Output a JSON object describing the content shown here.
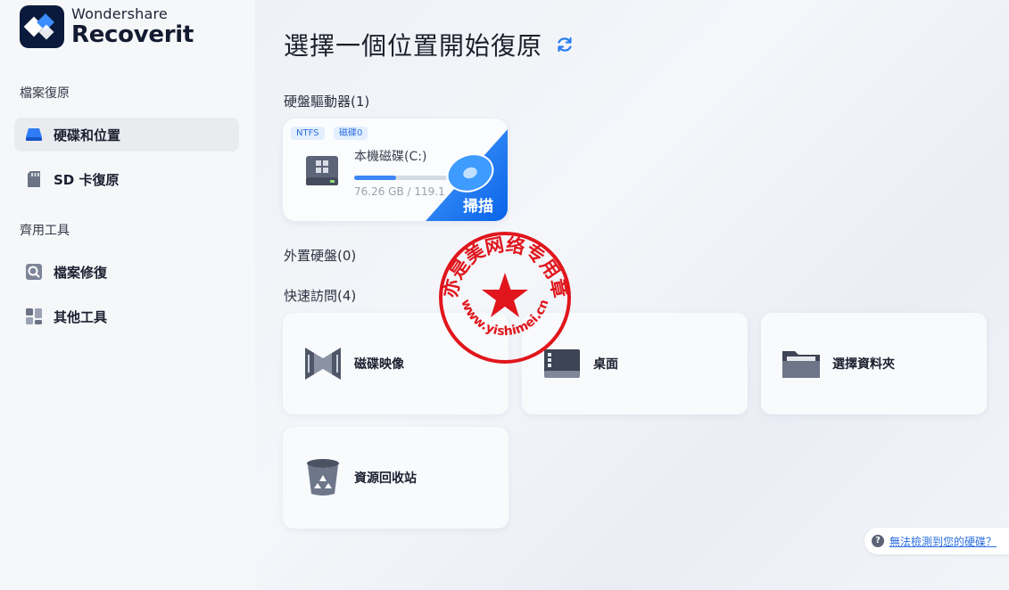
{
  "brand": {
    "line1": "Wondershare",
    "line2": "Recoverit"
  },
  "sidebar": {
    "section1_label": "檔案復原",
    "items1": [
      {
        "label": "硬碟和位置",
        "icon": "drive-icon",
        "active": true
      },
      {
        "label": "SD 卡復原",
        "icon": "sd-card-icon",
        "active": false
      }
    ],
    "section2_label": "齊用工具",
    "items2": [
      {
        "label": "檔案修復",
        "icon": "file-repair-icon"
      },
      {
        "label": "其他工具",
        "icon": "tools-grid-icon"
      }
    ]
  },
  "main": {
    "title": "選擇一個位置開始復原",
    "hard_drives_label": "硬盤驅動器(1)",
    "drive": {
      "tag_fs": "NTFS",
      "tag_disk": "磁碟0",
      "name": "本機磁碟(C:)",
      "size_text": "76.26 GB / 119.1",
      "usage_fraction": 0.45,
      "scan_label": "掃描"
    },
    "external_label": "外置硬盤(0)",
    "quick_access_label": "快速訪問(4)",
    "quick_access": [
      {
        "label": "磁碟映像",
        "icon": "disk-image-icon"
      },
      {
        "label": "桌面",
        "icon": "desktop-icon"
      },
      {
        "label": "選擇資料夾",
        "icon": "folder-icon"
      },
      {
        "label": "資源回收站",
        "icon": "recycle-bin-icon"
      }
    ],
    "help_text": "無法檢測到您的硬碟？"
  },
  "seal": {
    "text_top": "亦是美网络专用章",
    "text_bottom": "www.yishimei.cn"
  },
  "colors": {
    "accent": "#1677ff",
    "seal_red": "#e0161c",
    "sidebar_bg": "#f6f7f9"
  }
}
